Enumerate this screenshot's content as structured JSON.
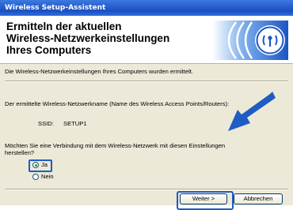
{
  "window": {
    "title": "Wireless Setup-Assistent"
  },
  "header": {
    "title_lines": [
      "Ermitteln der aktuellen",
      "Wireless-Netzwerkeinstellungen",
      "Ihres Computers"
    ]
  },
  "content": {
    "info": "Die Wireless-Netzwerkeinstellungen Ihres Computers wurden ermittelt.",
    "network_label": "Der ermittelte Wireless-Netzwerkname (Name des Wireless Access Points/Routers):",
    "ssid_label": "SSID:",
    "ssid_value": "SETUP1",
    "question_line1": "Möchten Sie eine Verbindung mit dem Wireless-Netzwerk mit diesen Einstellungen",
    "question_line2": "herstellen?",
    "options": [
      {
        "label": "Ja",
        "selected": true
      },
      {
        "label": "Nein",
        "selected": false
      }
    ]
  },
  "buttons": {
    "next": "Weiter >",
    "cancel": "Abbrechen"
  },
  "icons": {
    "header": "wireless-signal-icon",
    "pointer": "arrow-icon"
  },
  "colors": {
    "titlebar": "#2a63cf",
    "accent_blue": "#1f5cc4",
    "dialog_bg": "#ece9d8"
  }
}
